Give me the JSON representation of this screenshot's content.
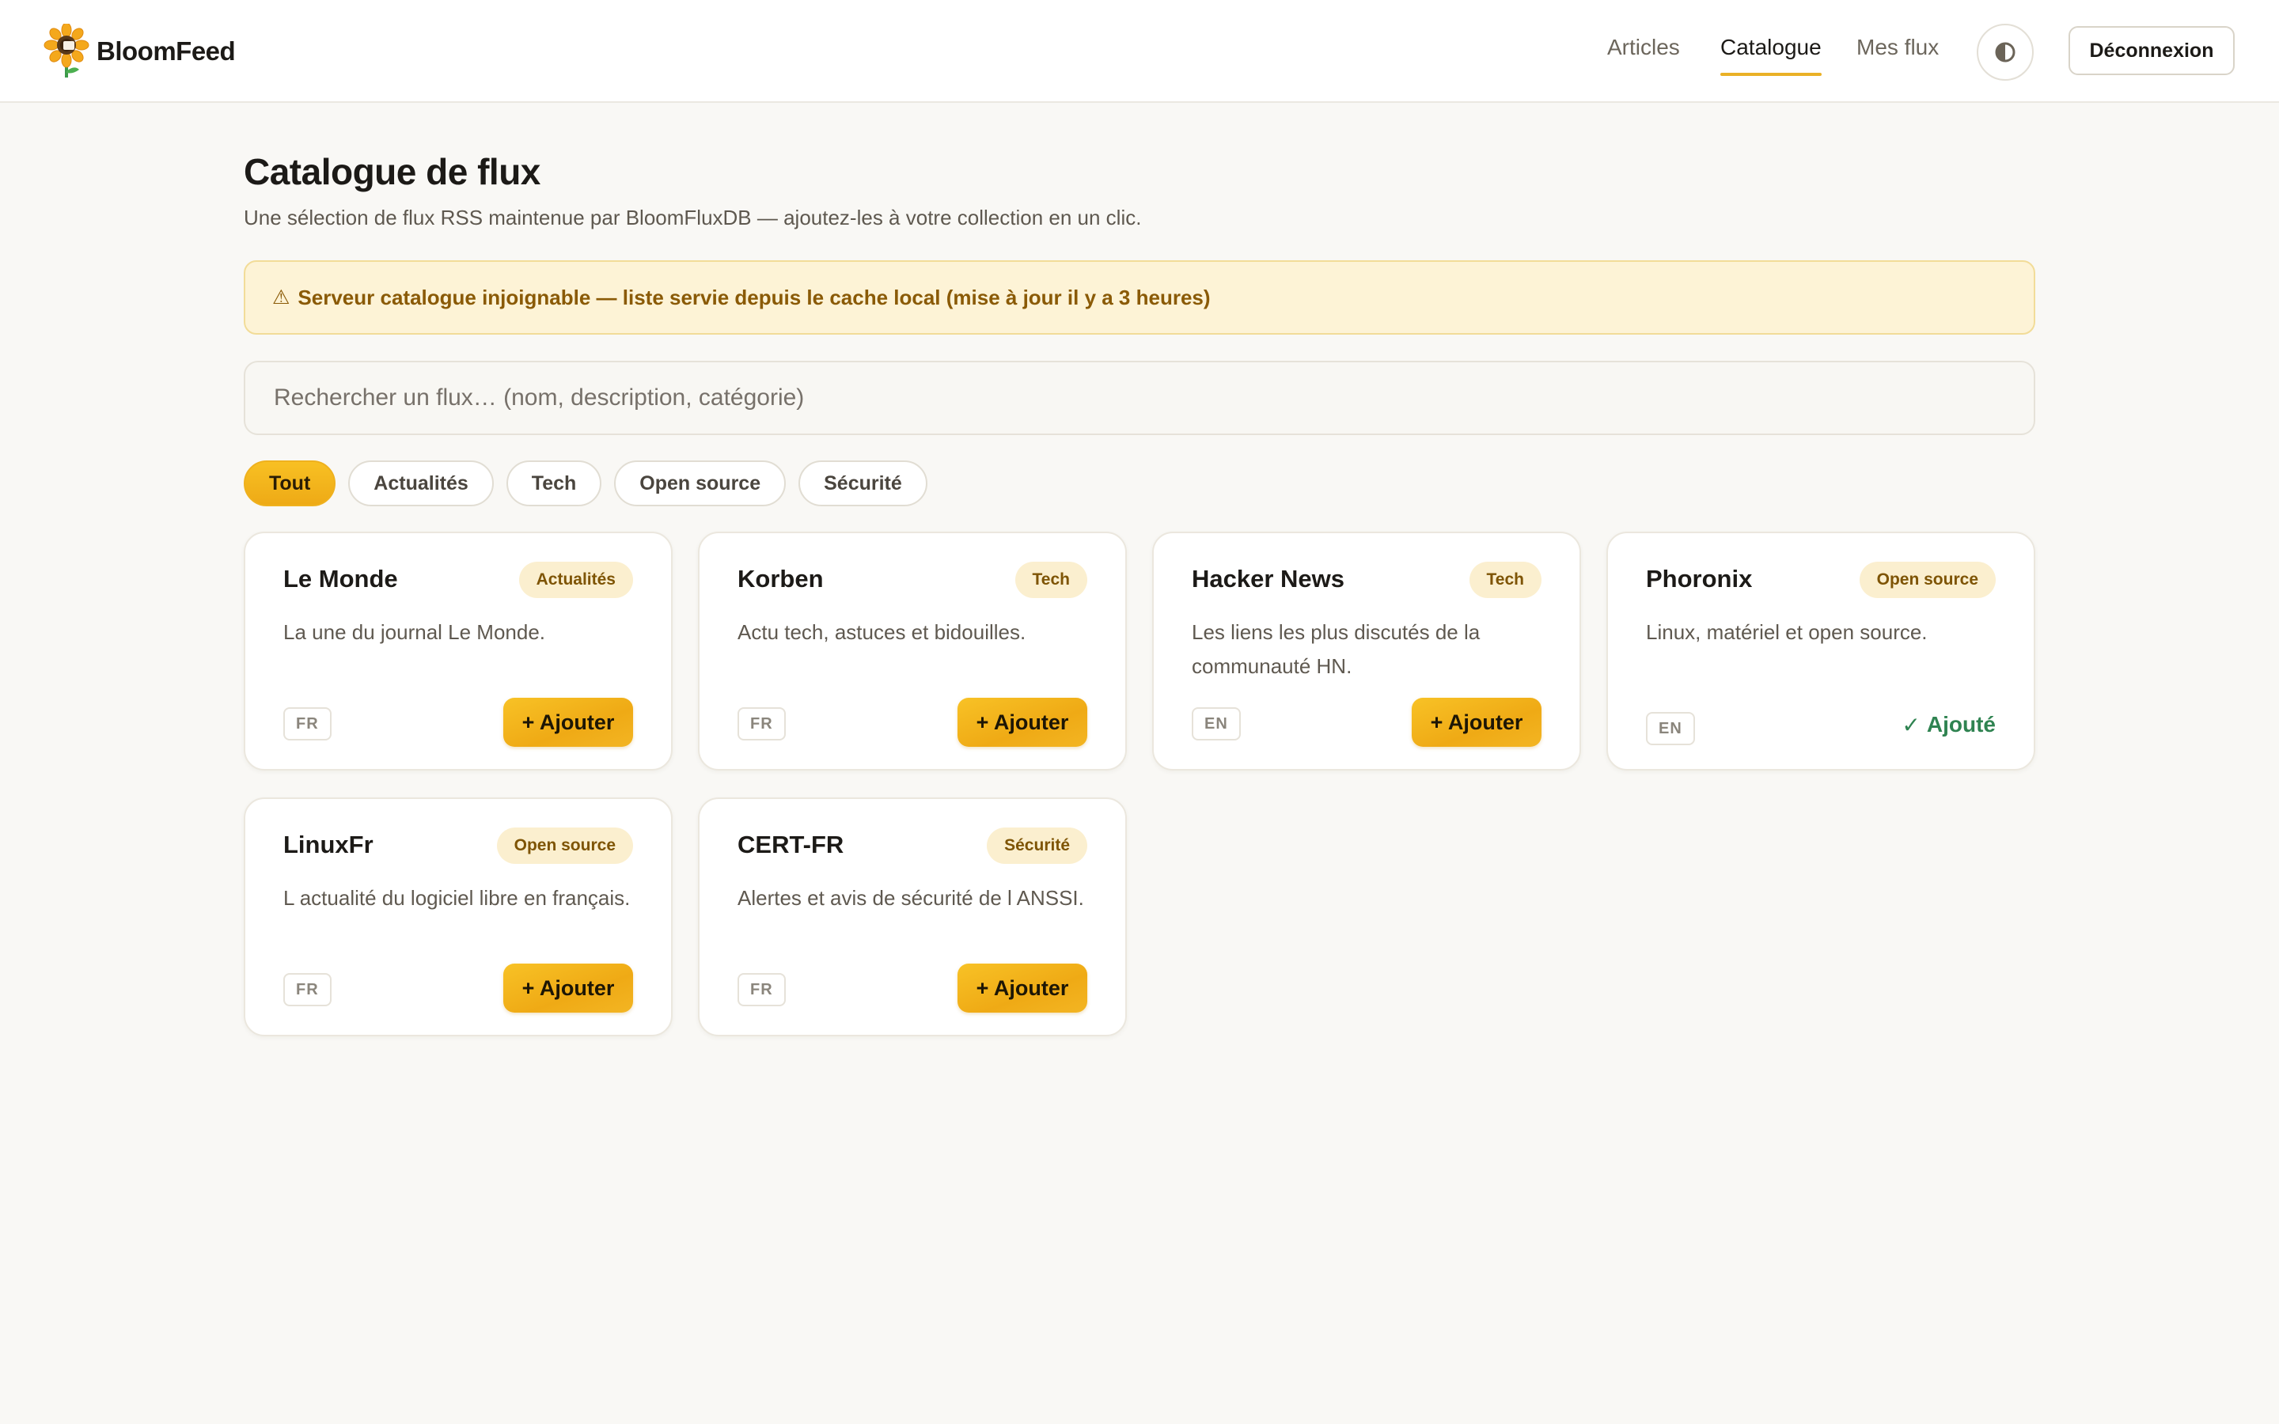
{
  "app": {
    "name": "BloomFeed"
  },
  "nav": {
    "articles": "Articles",
    "catalogue": "Catalogue",
    "my_feeds": "Mes flux",
    "logout": "Déconnexion"
  },
  "page": {
    "title": "Catalogue de flux",
    "subtitle": "Une sélection de flux RSS maintenue par BloomFluxDB — ajoutez-les à votre collection en un clic."
  },
  "alert": {
    "icon": "warning-icon",
    "icon_glyph": "⚠",
    "text": "Serveur catalogue injoignable — liste servie depuis le cache local (mise à jour il y a 3 heures)"
  },
  "search": {
    "placeholder": "Rechercher un flux… (nom, description, catégorie)",
    "value": ""
  },
  "filters": [
    {
      "label": "Tout",
      "active": true
    },
    {
      "label": "Actualités",
      "active": false
    },
    {
      "label": "Tech",
      "active": false
    },
    {
      "label": "Open source",
      "active": false
    },
    {
      "label": "Sécurité",
      "active": false
    }
  ],
  "add_label": "+ Ajouter",
  "added_label": "Ajouté",
  "feeds": [
    {
      "name": "Le Monde",
      "category": "Actualités",
      "description": "La une du journal Le Monde.",
      "lang": "FR",
      "added": false
    },
    {
      "name": "Korben",
      "category": "Tech",
      "description": "Actu tech, astuces et bidouilles.",
      "lang": "FR",
      "added": false
    },
    {
      "name": "Hacker News",
      "category": "Tech",
      "description": "Les liens les plus discutés de la communauté HN.",
      "lang": "EN",
      "added": false
    },
    {
      "name": "Phoronix",
      "category": "Open source",
      "description": "Linux, matériel et open source.",
      "lang": "EN",
      "added": true
    },
    {
      "name": "LinuxFr",
      "category": "Open source",
      "description": "L actualité du logiciel libre en français.",
      "lang": "FR",
      "added": false
    },
    {
      "name": "CERT-FR",
      "category": "Sécurité",
      "description": "Alertes et avis de sécurité de l ANSSI.",
      "lang": "FR",
      "added": false
    }
  ],
  "colors": {
    "accent": "#f2b31d",
    "accent_dark": "#eab126",
    "alert_bg": "#fdf3d6",
    "alert_text": "#8a5a06",
    "added_green": "#2f8351",
    "background": "#f9f8f5"
  }
}
